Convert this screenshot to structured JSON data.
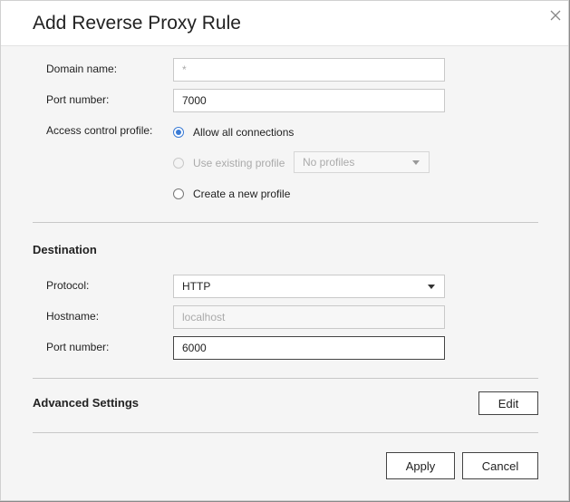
{
  "dialog": {
    "title": "Add Reverse Proxy Rule"
  },
  "source": {
    "domain_label": "Domain name:",
    "domain_placeholder": "*",
    "port_label": "Port number:",
    "port_value": "7000",
    "access_label": "Access control profile:",
    "options": [
      {
        "label": "Allow all connections",
        "checked": true,
        "disabled": false
      },
      {
        "label": "Use existing profile",
        "checked": false,
        "disabled": true
      },
      {
        "label": "Create a new profile",
        "checked": false,
        "disabled": false
      }
    ],
    "profile_select": "No profiles"
  },
  "destination": {
    "heading": "Destination",
    "protocol_label": "Protocol:",
    "protocol_value": "HTTP",
    "hostname_label": "Hostname:",
    "hostname_placeholder": "localhost",
    "port_label": "Port number:",
    "port_value": "6000"
  },
  "advanced": {
    "heading": "Advanced Settings",
    "edit_label": "Edit"
  },
  "footer": {
    "apply_label": "Apply",
    "cancel_label": "Cancel"
  },
  "colors": {
    "accent": "#3a7bd5"
  }
}
